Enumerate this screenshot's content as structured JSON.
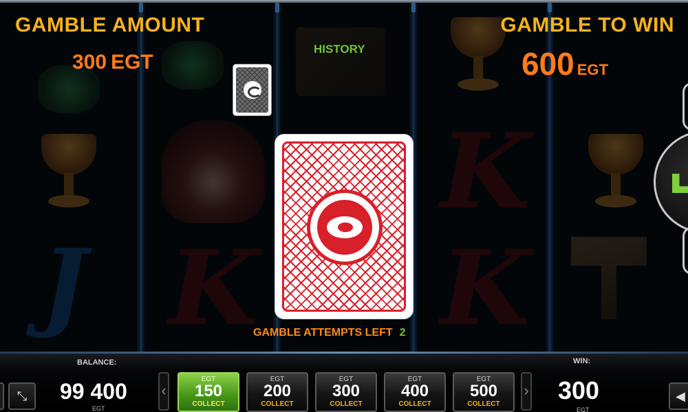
{
  "gamble": {
    "amount_label": "GAMBLE AMOUNT",
    "amount_value": "300",
    "amount_unit": "EGT",
    "history_label": "HISTORY",
    "to_win_label": "GAMBLE TO WIN",
    "to_win_value": "600",
    "to_win_unit": "EGT",
    "attempts_label": "GAMBLE ATTEMPTS LEFT",
    "attempts_count": "2"
  },
  "background_symbols": {
    "letter_k": "K",
    "letter_j": "J"
  },
  "bottom_bar": {
    "balance_label": "BALANCE:",
    "balance_value": "99 400",
    "balance_unit": "EGT",
    "win_label": "WIN:",
    "win_value": "300",
    "win_unit": "EGT",
    "arrow_left": "‹",
    "arrow_right": "›",
    "fullscreen_icon": "⤡",
    "sound_icon": "◀",
    "bets": [
      {
        "currency": "EGT",
        "amount": "150",
        "action": "COLLECT",
        "active": true
      },
      {
        "currency": "EGT",
        "amount": "200",
        "action": "COLLECT",
        "active": false
      },
      {
        "currency": "EGT",
        "amount": "300",
        "action": "COLLECT",
        "active": false
      },
      {
        "currency": "EGT",
        "amount": "400",
        "action": "COLLECT",
        "active": false
      },
      {
        "currency": "EGT",
        "amount": "500",
        "action": "COLLECT",
        "active": false
      }
    ]
  },
  "colors": {
    "label_gold": "#f5b21b",
    "value_orange": "#ff7a1a",
    "history_green": "#6fc23a",
    "card_red": "#d8202a",
    "active_bet_green": "#6fbf2a"
  }
}
